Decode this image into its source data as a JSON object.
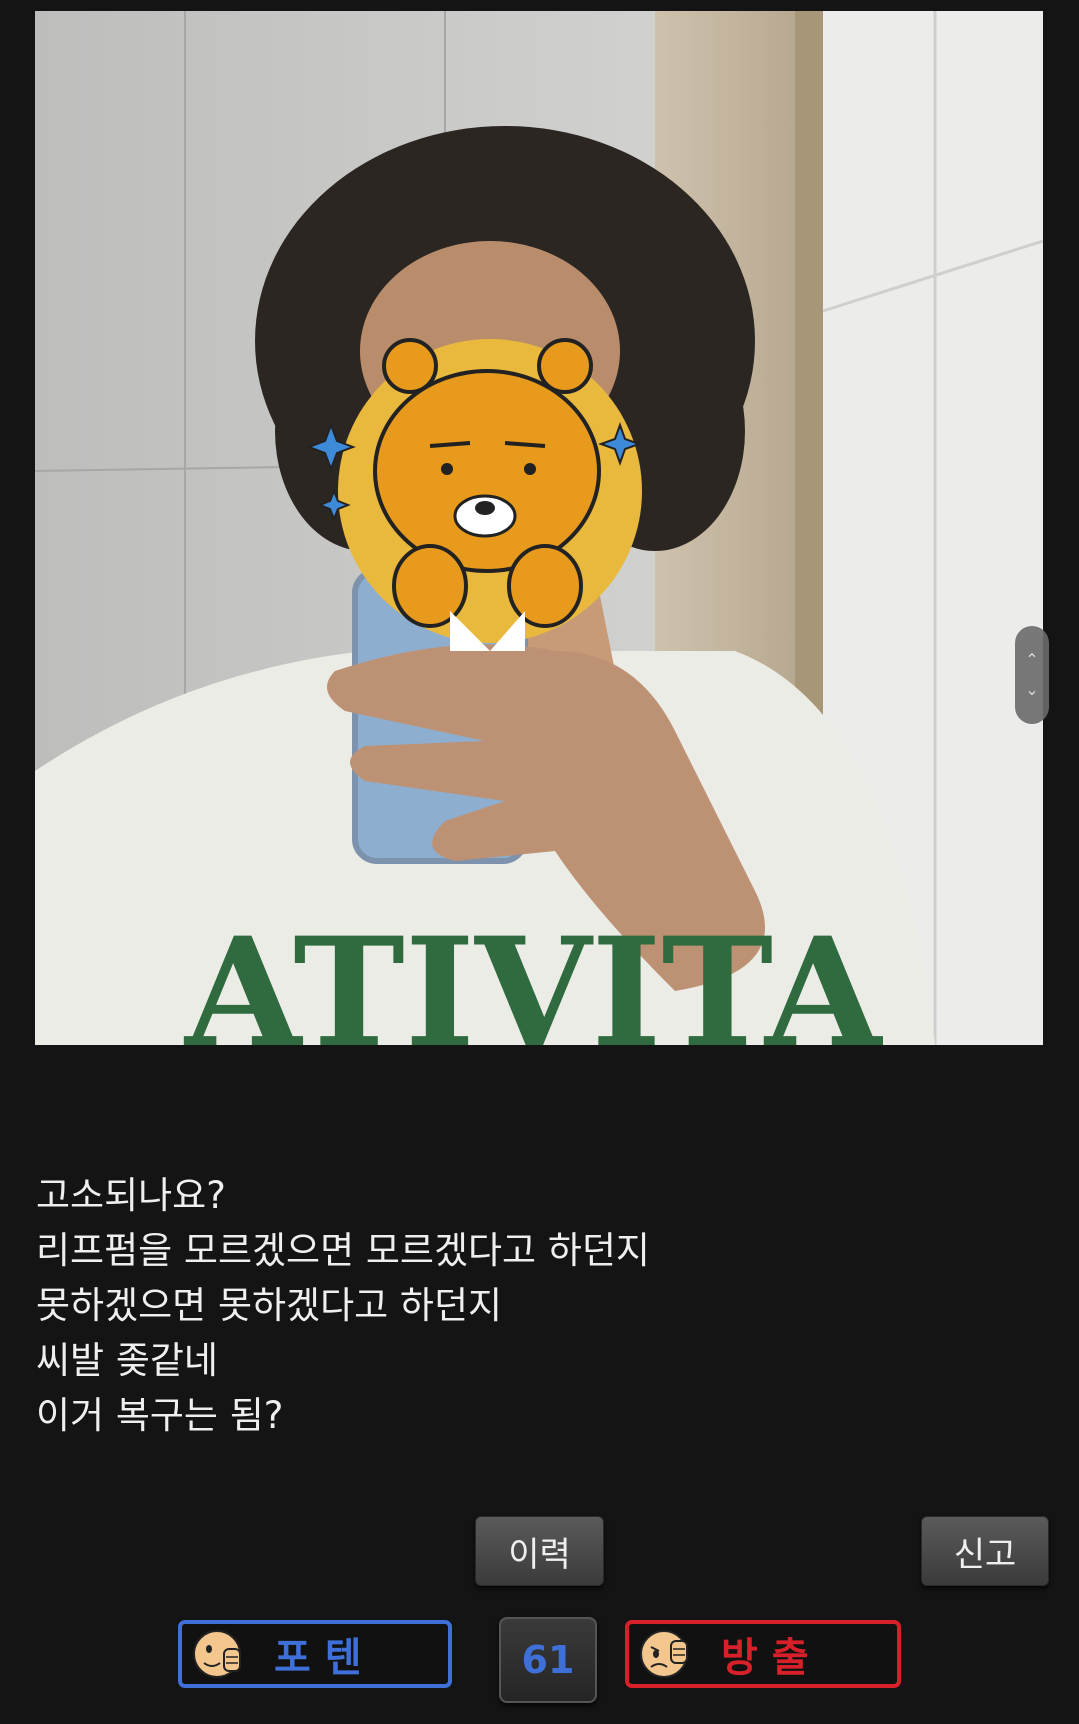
{
  "post": {
    "body_lines": [
      "고소되나요?",
      "리프펌을 모르겠으면 모르겠다고 하던지",
      "못하겠으면 못하겠다고 하던지",
      "씨발 좆같네",
      "이거 복구는 됨?"
    ]
  },
  "actions": {
    "history_label": "이력",
    "report_label": "신고"
  },
  "vote": {
    "up_label": "포텐",
    "down_label": "방출",
    "count": "61",
    "up_color": "#3f6fd8",
    "down_color": "#d8202a"
  },
  "photo": {
    "shirt_text": "ATIVITA"
  },
  "icons": {
    "scroll_up": "chevron-up-icon",
    "scroll_down": "chevron-down-icon",
    "thumbs_up_face": "thumbs-up-face-icon",
    "thumbs_down_face": "thumbs-down-face-icon"
  }
}
